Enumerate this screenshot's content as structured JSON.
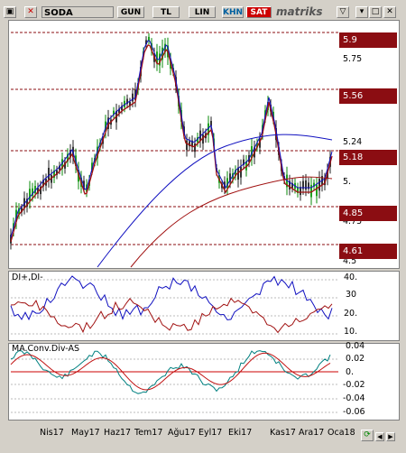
{
  "toolbar": {
    "symbol": "SODA",
    "buttons": [
      "GUN",
      "TL",
      "LIN",
      "KHN",
      "SAT"
    ],
    "brand": "matriks"
  },
  "price_axis": {
    "ticks": [
      "5.75",
      "5.24",
      "5.",
      "4.75",
      "4.5"
    ],
    "levels": [
      "5.9",
      "5.56",
      "5.18",
      "4.85",
      "4.61"
    ]
  },
  "di_panel": {
    "title": "DI+,DI-",
    "ticks": [
      "40.",
      "30",
      "20.",
      "10."
    ]
  },
  "macd_panel": {
    "title": "MA.Conv.Div-AS",
    "ticks": [
      "0.04",
      "0.02",
      "0.",
      "-0.02",
      "-0.04",
      "-0.06"
    ]
  },
  "months": [
    "Nis17",
    "May17",
    "Haz17",
    "Tem17",
    "Ağu17",
    "Eyl17",
    "Eki17",
    "Kas17",
    "Ara17",
    "Oca18"
  ],
  "colors": {
    "level_red": "#8b0d12",
    "ma_blue": "#1010c0",
    "ma_red": "#a01010",
    "accent": "#008080"
  }
}
